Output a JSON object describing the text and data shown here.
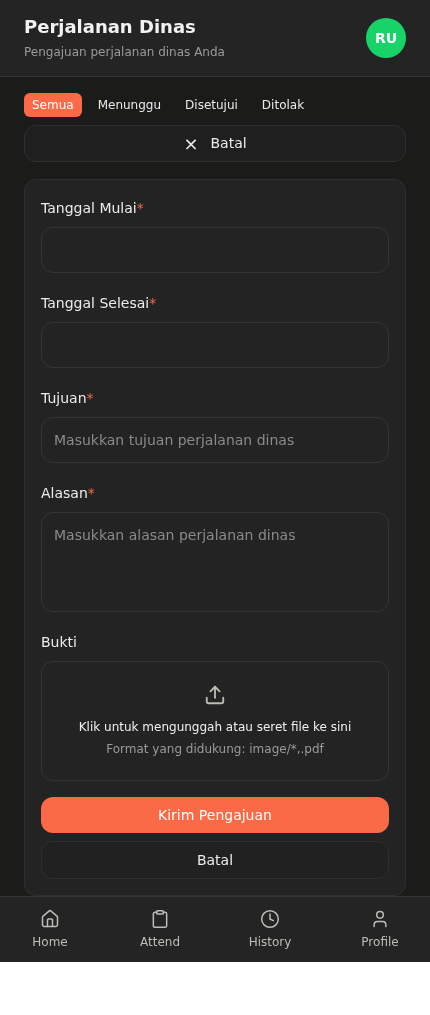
{
  "header": {
    "title": "Perjalanan Dinas",
    "subtitle": "Pengajuan perjalanan dinas Anda",
    "avatar": "RU"
  },
  "tabs": [
    {
      "label": "Semua",
      "selected": true
    },
    {
      "label": "Menunggu",
      "selected": false
    },
    {
      "label": "Disetujui",
      "selected": false
    },
    {
      "label": "Ditolak",
      "selected": false
    }
  ],
  "cancel_toggle": {
    "icon": "×",
    "label": "Batal"
  },
  "form": {
    "fields": [
      {
        "kind": "date",
        "label": "Tanggal Mulai",
        "required_mark": "*"
      },
      {
        "kind": "date",
        "label": "Tanggal Selesai",
        "required_mark": "*"
      },
      {
        "kind": "text",
        "label": "Tujuan",
        "required_mark": "*",
        "placeholder": "Masukkan tujuan perjalanan dinas"
      },
      {
        "kind": "textarea",
        "label": "Alasan",
        "required_mark": "*",
        "placeholder": "Masukkan alasan perjalanan dinas"
      },
      {
        "kind": "file",
        "label": "Bukti",
        "prompt": "Klik untuk mengunggah atau seret file ke sini",
        "hint": "Format yang didukung: image/*,.pdf"
      }
    ],
    "submit": "Kirim Pengajuan",
    "cancel": "Batal"
  },
  "nav": [
    {
      "kind": "home",
      "label": "Home"
    },
    {
      "kind": "attend",
      "label": "Attend"
    },
    {
      "kind": "history",
      "label": "History"
    },
    {
      "kind": "profile",
      "label": "Profile"
    }
  ]
}
